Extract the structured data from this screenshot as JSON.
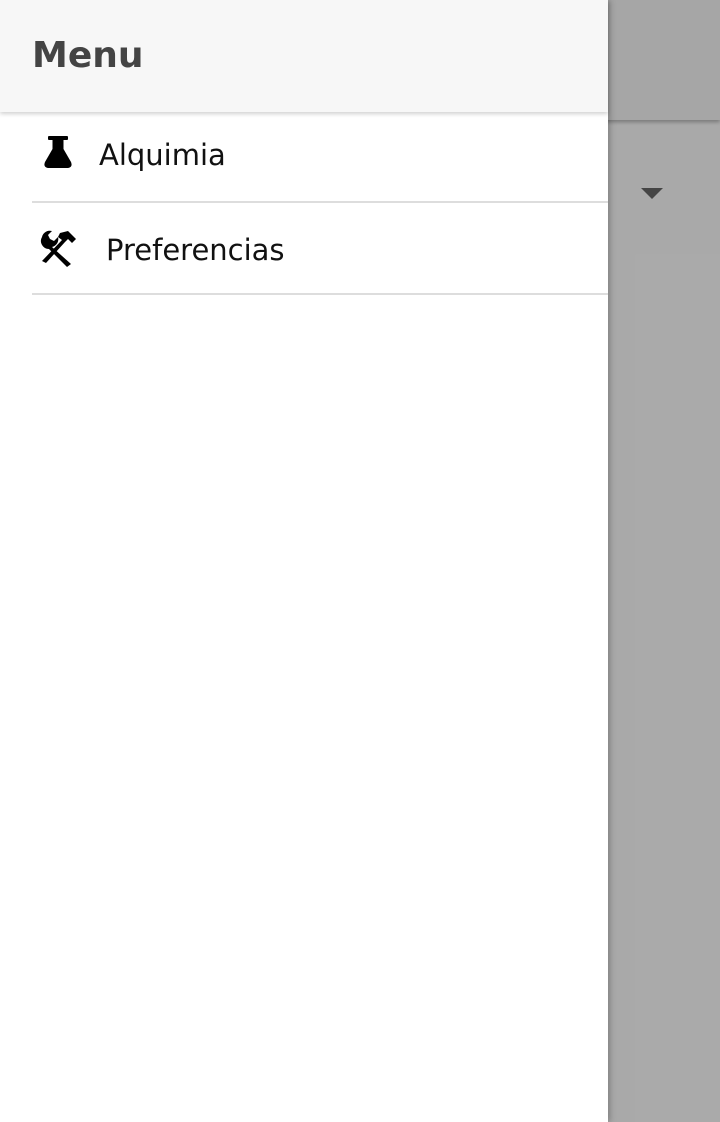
{
  "drawer": {
    "title": "Menu",
    "items": [
      {
        "label": "Alquimia",
        "icon": "flask-icon"
      },
      {
        "label": "Preferencias",
        "icon": "tools-icon"
      }
    ]
  },
  "background": {
    "dropdown_icon": "chevron-down-icon"
  },
  "colors": {
    "drawer_header": "#f7f7f7",
    "drawer_title": "#444444",
    "divider": "#dddddd",
    "scrim": "#a6a6a6"
  }
}
